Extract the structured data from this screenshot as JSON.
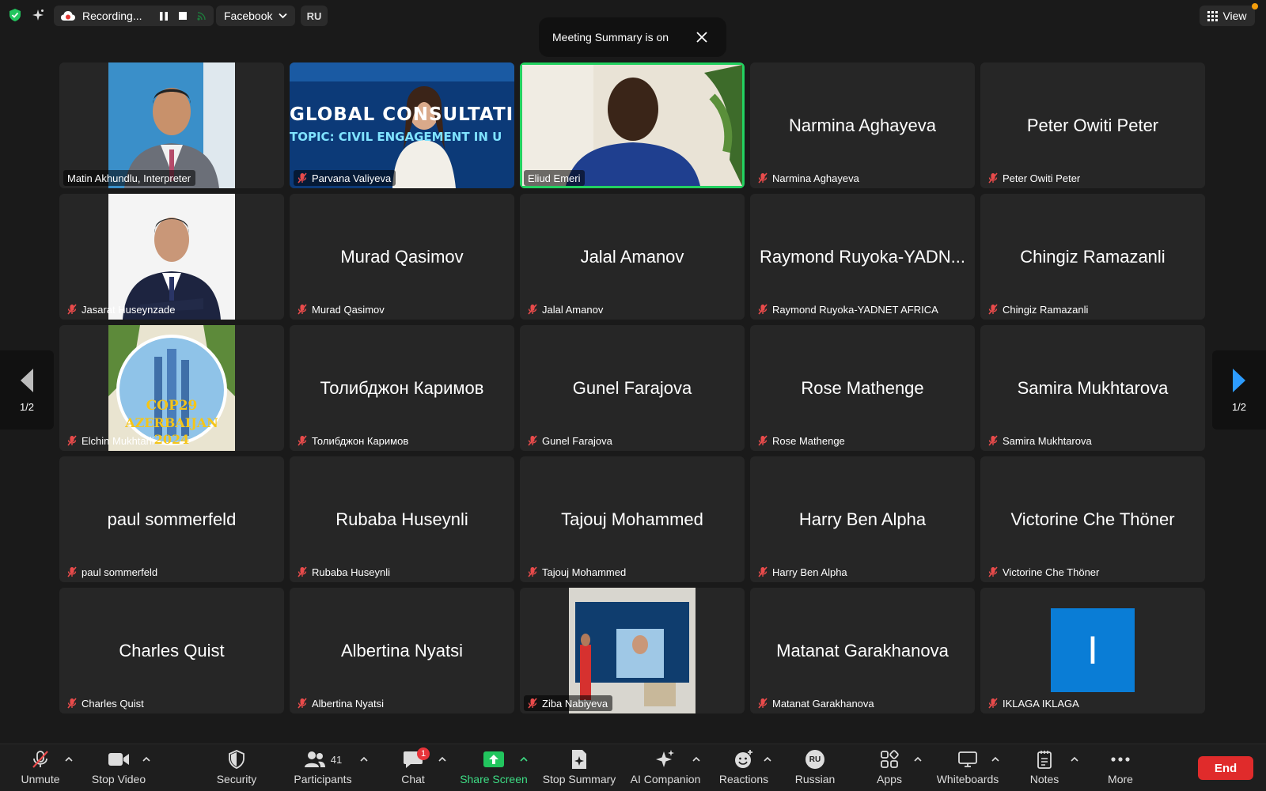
{
  "topbar": {
    "recording_label": "Recording...",
    "stream_target": "Facebook",
    "language_badge": "RU",
    "view_label": "View"
  },
  "toast": {
    "text": "Meeting Summary is on"
  },
  "pager": {
    "left": "1/2",
    "right": "1/2"
  },
  "tiles": [
    {
      "label": "Matin Akhundlu, Interpreter",
      "big": ""
    },
    {
      "label": "Parvana Valiyeva",
      "big": ""
    },
    {
      "label": "Eliud Emeri",
      "big": ""
    },
    {
      "label": "Narmina Aghayeva",
      "big": "Narmina Aghayeva"
    },
    {
      "label": "Peter Owiti Peter",
      "big": "Peter Owiti Peter"
    },
    {
      "label": "Jasarat Huseynzade",
      "big": ""
    },
    {
      "label": "Murad Qasimov",
      "big": "Murad Qasimov"
    },
    {
      "label": "Jalal Amanov",
      "big": "Jalal Amanov"
    },
    {
      "label": "Raymond Ruyoka-YADNET AFRICA",
      "big": "Raymond Ruyoka-YADN..."
    },
    {
      "label": "Chingiz Ramazanli",
      "big": "Chingiz Ramazanli"
    },
    {
      "label": "Elchin Mukhtarli",
      "big": ""
    },
    {
      "label": "Толибджон Каримов",
      "big": "Толибджон Каримов"
    },
    {
      "label": "Gunel Farajova",
      "big": "Gunel Farajova"
    },
    {
      "label": "Rose Mathenge",
      "big": "Rose Mathenge"
    },
    {
      "label": "Samira Mukhtarova",
      "big": "Samira Mukhtarova"
    },
    {
      "label": "paul sommerfeld",
      "big": "paul sommerfeld"
    },
    {
      "label": "Rubaba Huseynli",
      "big": "Rubaba Huseynli"
    },
    {
      "label": "Tajouj Mohammed",
      "big": "Tajouj Mohammed"
    },
    {
      "label": "Harry Ben Alpha",
      "big": "Harry Ben Alpha"
    },
    {
      "label": "Victorine Che Thöner",
      "big": "Victorine Che Thöner"
    },
    {
      "label": "Charles Quist",
      "big": "Charles Quist"
    },
    {
      "label": "Albertina Nyatsi",
      "big": "Albertina Nyatsi"
    },
    {
      "label": "Ziba Nabiyeva",
      "big": ""
    },
    {
      "label": "Matanat Garakhanova",
      "big": "Matanat Garakhanova"
    },
    {
      "label": "IKLAGA IKLAGA",
      "big": ""
    }
  ],
  "images": {
    "banner_text": "GLOBAL CONSULTATION",
    "banner_sub": "TOPIC: CIVIL ENGAGEMENT IN U",
    "cop_line1": "COP29",
    "cop_line2": "AZERBAIJAN",
    "cop_line3": "2024",
    "iklaga_avatar_letter": "I"
  },
  "toolbar": {
    "unmute": "Unmute",
    "stop_video": "Stop Video",
    "security": "Security",
    "participants": "Participants",
    "participants_count": "41",
    "chat": "Chat",
    "chat_badge": "1",
    "share_screen": "Share Screen",
    "stop_summary": "Stop Summary",
    "ai_companion": "AI Companion",
    "reactions": "Reactions",
    "russian": "Russian",
    "russian_badge": "RU",
    "apps": "Apps",
    "whiteboards": "Whiteboards",
    "notes": "Notes",
    "more": "More",
    "end": "End"
  },
  "colors": {
    "active_speaker": "#23d160",
    "end_button": "#e02b2b",
    "share_green": "#3ddc84",
    "pager_arrow": "#2d9cff"
  }
}
